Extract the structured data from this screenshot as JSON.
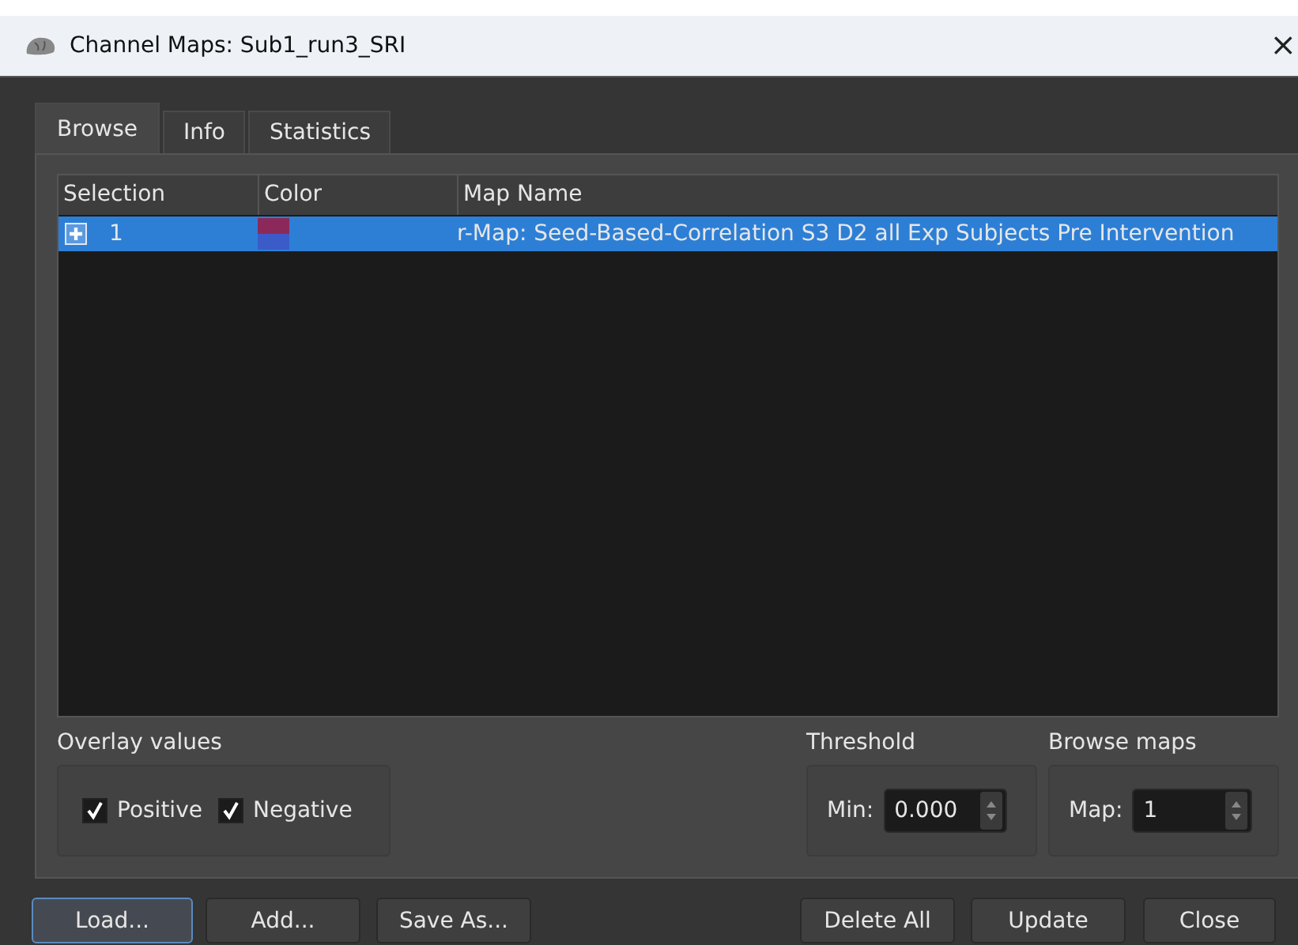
{
  "window": {
    "title": "Channel Maps: Sub1_run3_SRI",
    "close": "×"
  },
  "tabs": [
    {
      "label": "Browse",
      "selected": true
    },
    {
      "label": "Info",
      "selected": false
    },
    {
      "label": "Statistics",
      "selected": false
    }
  ],
  "table": {
    "columns": [
      "Selection",
      "Color",
      "Map Name"
    ],
    "rows": [
      {
        "index": "1",
        "expanded": false,
        "selected": true,
        "swatch": [
          {
            "color": "#8b2a5a"
          },
          {
            "color": "#3a5bc8"
          }
        ],
        "map_name": "r-Map: Seed-Based-Correlation S3 D2 all Exp Subjects Pre Intervention"
      }
    ]
  },
  "overlay_values": {
    "title": "Overlay values",
    "options": [
      {
        "label": "Positive",
        "checked": true
      },
      {
        "label": "Negative",
        "checked": true
      }
    ]
  },
  "threshold": {
    "title": "Threshold",
    "label": "Min:",
    "value": "0.000"
  },
  "browse_maps": {
    "title": "Browse maps",
    "label": "Map:",
    "value": "1"
  },
  "buttons": [
    {
      "label": "Load...",
      "focused": true
    },
    {
      "label": "Add...",
      "focused": false
    },
    {
      "label": "Save As...",
      "focused": false
    },
    {
      "label": "Delete All",
      "focused": false
    },
    {
      "label": "Update",
      "focused": false
    },
    {
      "label": "Close",
      "focused": false
    }
  ]
}
